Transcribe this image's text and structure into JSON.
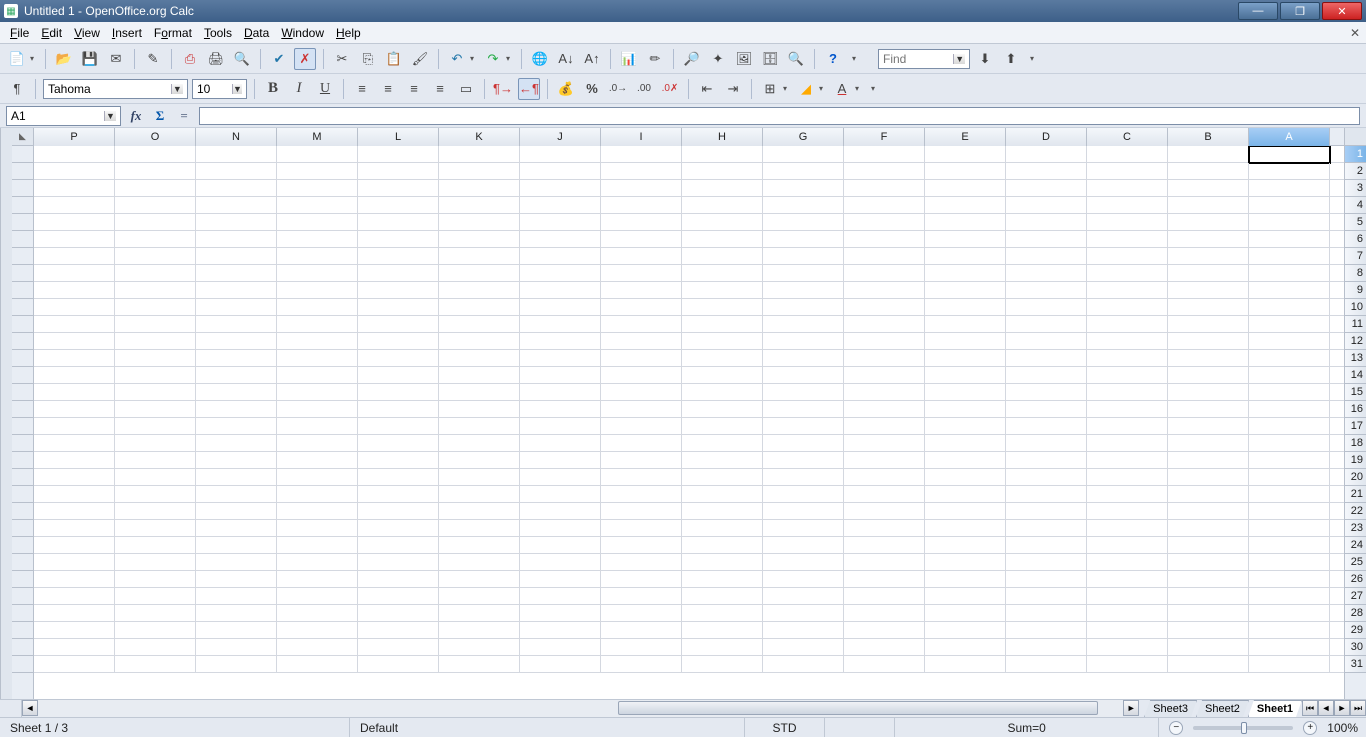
{
  "window": {
    "title": "Untitled 1 - OpenOffice.org Calc"
  },
  "menus": [
    "File",
    "Edit",
    "View",
    "Insert",
    "Format",
    "Tools",
    "Data",
    "Window",
    "Help"
  ],
  "toolbar1_icons": [
    "new",
    "open",
    "save",
    "mail",
    "sep",
    "edit-doc",
    "sep",
    "pdf",
    "print",
    "preview",
    "sep",
    "spellcheck",
    "autospell",
    "sep",
    "cut",
    "copy",
    "paste",
    "format-paint",
    "sep",
    "undo",
    "redo",
    "sep",
    "hyperlink",
    "sort-asc",
    "sort-desc",
    "sep",
    "chart",
    "show-draw",
    "sep",
    "find-replace",
    "navigator",
    "gallery",
    "datasources",
    "zoom",
    "sep",
    "help"
  ],
  "find_placeholder": "Find",
  "font_name": "Tahoma",
  "font_size": "10",
  "cell_ref": "A1",
  "formula_value": "",
  "columns": [
    "P",
    "O",
    "N",
    "M",
    "L",
    "K",
    "J",
    "I",
    "H",
    "G",
    "F",
    "E",
    "D",
    "C",
    "B",
    "A"
  ],
  "rows": [
    "1",
    "2",
    "3",
    "4",
    "5",
    "6",
    "7",
    "8",
    "9",
    "10",
    "11",
    "12",
    "13",
    "14",
    "15",
    "16",
    "17",
    "18",
    "19",
    "20",
    "21",
    "22",
    "23",
    "24",
    "25",
    "26",
    "27",
    "28",
    "29",
    "30",
    "31"
  ],
  "active_col": "A",
  "active_row": "1",
  "sheet_tabs": [
    "Sheet3",
    "Sheet2",
    "Sheet1"
  ],
  "active_tab": "Sheet1",
  "status": {
    "sheet": "Sheet 1 / 3",
    "style": "Default",
    "mode": "STD",
    "sum": "Sum=0",
    "zoom": "100%"
  }
}
